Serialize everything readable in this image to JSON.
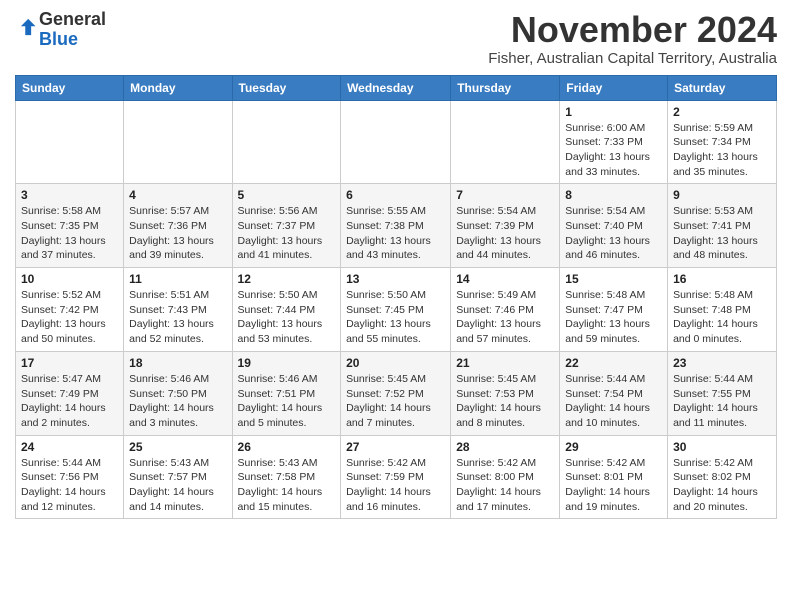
{
  "header": {
    "logo_general": "General",
    "logo_blue": "Blue",
    "month_title": "November 2024",
    "location": "Fisher, Australian Capital Territory, Australia"
  },
  "calendar": {
    "days_of_week": [
      "Sunday",
      "Monday",
      "Tuesday",
      "Wednesday",
      "Thursday",
      "Friday",
      "Saturday"
    ],
    "weeks": [
      [
        {
          "day": "",
          "info": ""
        },
        {
          "day": "",
          "info": ""
        },
        {
          "day": "",
          "info": ""
        },
        {
          "day": "",
          "info": ""
        },
        {
          "day": "",
          "info": ""
        },
        {
          "day": "1",
          "info": "Sunrise: 6:00 AM\nSunset: 7:33 PM\nDaylight: 13 hours and 33 minutes."
        },
        {
          "day": "2",
          "info": "Sunrise: 5:59 AM\nSunset: 7:34 PM\nDaylight: 13 hours and 35 minutes."
        }
      ],
      [
        {
          "day": "3",
          "info": "Sunrise: 5:58 AM\nSunset: 7:35 PM\nDaylight: 13 hours and 37 minutes."
        },
        {
          "day": "4",
          "info": "Sunrise: 5:57 AM\nSunset: 7:36 PM\nDaylight: 13 hours and 39 minutes."
        },
        {
          "day": "5",
          "info": "Sunrise: 5:56 AM\nSunset: 7:37 PM\nDaylight: 13 hours and 41 minutes."
        },
        {
          "day": "6",
          "info": "Sunrise: 5:55 AM\nSunset: 7:38 PM\nDaylight: 13 hours and 43 minutes."
        },
        {
          "day": "7",
          "info": "Sunrise: 5:54 AM\nSunset: 7:39 PM\nDaylight: 13 hours and 44 minutes."
        },
        {
          "day": "8",
          "info": "Sunrise: 5:54 AM\nSunset: 7:40 PM\nDaylight: 13 hours and 46 minutes."
        },
        {
          "day": "9",
          "info": "Sunrise: 5:53 AM\nSunset: 7:41 PM\nDaylight: 13 hours and 48 minutes."
        }
      ],
      [
        {
          "day": "10",
          "info": "Sunrise: 5:52 AM\nSunset: 7:42 PM\nDaylight: 13 hours and 50 minutes."
        },
        {
          "day": "11",
          "info": "Sunrise: 5:51 AM\nSunset: 7:43 PM\nDaylight: 13 hours and 52 minutes."
        },
        {
          "day": "12",
          "info": "Sunrise: 5:50 AM\nSunset: 7:44 PM\nDaylight: 13 hours and 53 minutes."
        },
        {
          "day": "13",
          "info": "Sunrise: 5:50 AM\nSunset: 7:45 PM\nDaylight: 13 hours and 55 minutes."
        },
        {
          "day": "14",
          "info": "Sunrise: 5:49 AM\nSunset: 7:46 PM\nDaylight: 13 hours and 57 minutes."
        },
        {
          "day": "15",
          "info": "Sunrise: 5:48 AM\nSunset: 7:47 PM\nDaylight: 13 hours and 59 minutes."
        },
        {
          "day": "16",
          "info": "Sunrise: 5:48 AM\nSunset: 7:48 PM\nDaylight: 14 hours and 0 minutes."
        }
      ],
      [
        {
          "day": "17",
          "info": "Sunrise: 5:47 AM\nSunset: 7:49 PM\nDaylight: 14 hours and 2 minutes."
        },
        {
          "day": "18",
          "info": "Sunrise: 5:46 AM\nSunset: 7:50 PM\nDaylight: 14 hours and 3 minutes."
        },
        {
          "day": "19",
          "info": "Sunrise: 5:46 AM\nSunset: 7:51 PM\nDaylight: 14 hours and 5 minutes."
        },
        {
          "day": "20",
          "info": "Sunrise: 5:45 AM\nSunset: 7:52 PM\nDaylight: 14 hours and 7 minutes."
        },
        {
          "day": "21",
          "info": "Sunrise: 5:45 AM\nSunset: 7:53 PM\nDaylight: 14 hours and 8 minutes."
        },
        {
          "day": "22",
          "info": "Sunrise: 5:44 AM\nSunset: 7:54 PM\nDaylight: 14 hours and 10 minutes."
        },
        {
          "day": "23",
          "info": "Sunrise: 5:44 AM\nSunset: 7:55 PM\nDaylight: 14 hours and 11 minutes."
        }
      ],
      [
        {
          "day": "24",
          "info": "Sunrise: 5:44 AM\nSunset: 7:56 PM\nDaylight: 14 hours and 12 minutes."
        },
        {
          "day": "25",
          "info": "Sunrise: 5:43 AM\nSunset: 7:57 PM\nDaylight: 14 hours and 14 minutes."
        },
        {
          "day": "26",
          "info": "Sunrise: 5:43 AM\nSunset: 7:58 PM\nDaylight: 14 hours and 15 minutes."
        },
        {
          "day": "27",
          "info": "Sunrise: 5:42 AM\nSunset: 7:59 PM\nDaylight: 14 hours and 16 minutes."
        },
        {
          "day": "28",
          "info": "Sunrise: 5:42 AM\nSunset: 8:00 PM\nDaylight: 14 hours and 17 minutes."
        },
        {
          "day": "29",
          "info": "Sunrise: 5:42 AM\nSunset: 8:01 PM\nDaylight: 14 hours and 19 minutes."
        },
        {
          "day": "30",
          "info": "Sunrise: 5:42 AM\nSunset: 8:02 PM\nDaylight: 14 hours and 20 minutes."
        }
      ]
    ]
  }
}
